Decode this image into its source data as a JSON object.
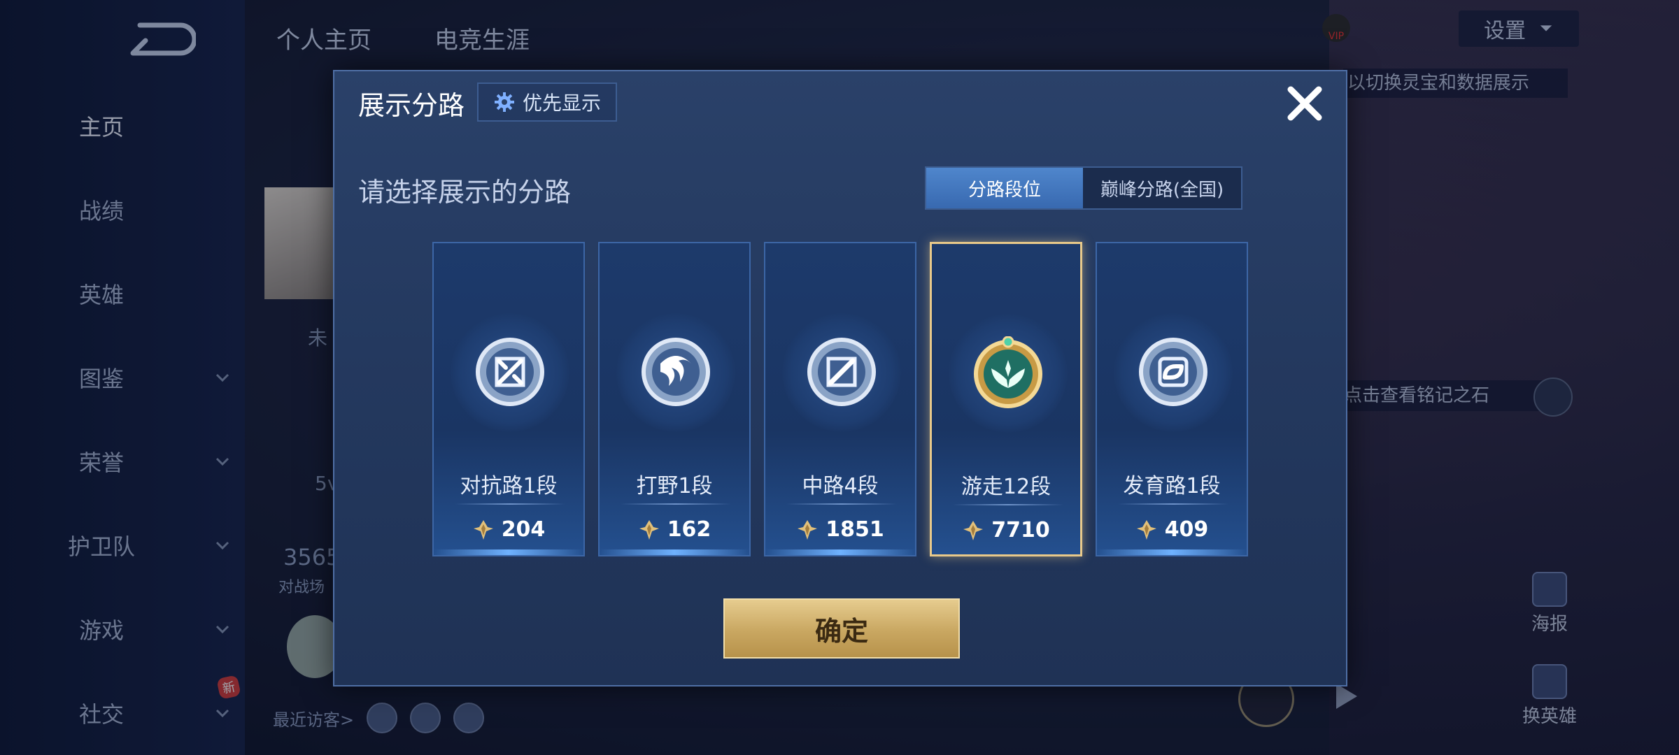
{
  "background": {
    "top_tabs": [
      "个人主页",
      "电竞生涯"
    ],
    "nav": [
      {
        "label": "主页",
        "has_chevron": false,
        "active": true
      },
      {
        "label": "战绩",
        "has_chevron": false
      },
      {
        "label": "英雄",
        "has_chevron": false
      },
      {
        "label": "图鉴",
        "has_chevron": true
      },
      {
        "label": "荣誉",
        "has_chevron": true
      },
      {
        "label": "护卫队",
        "has_chevron": true
      },
      {
        "label": "游戏",
        "has_chevron": true
      },
      {
        "label": "社交",
        "has_chevron": true
      }
    ],
    "new_badge": "新",
    "settings_label": "设置",
    "vip_label": "VIP",
    "hint_switch": "以切换灵宝和数据展示",
    "hint_stone": "点击查看铭记之石",
    "partial_texts": {
      "name": "未",
      "count": "5v",
      "stat": "3565",
      "stat_label": "对战场"
    },
    "visitors_label": "最近访客>",
    "side_actions": {
      "poster": "海报",
      "switch_hero": "换英雄"
    }
  },
  "dialog": {
    "title": "展示分路",
    "priority_button": "优先显示",
    "subtitle": "请选择展示的分路",
    "toggle": {
      "rank": "分路段位",
      "peak": "巅峰分路(全国)",
      "active": "rank"
    },
    "cards": [
      {
        "name": "对抗路1段",
        "score": "204",
        "icon": "sword-emblem-icon",
        "selected": false
      },
      {
        "name": "打野1段",
        "score": "162",
        "icon": "jungle-emblem-icon",
        "selected": false
      },
      {
        "name": "中路4段",
        "score": "1851",
        "icon": "mid-emblem-icon",
        "selected": false
      },
      {
        "name": "游走12段",
        "score": "7710",
        "icon": "roam-emblem-icon",
        "selected": true
      },
      {
        "name": "发育路1段",
        "score": "409",
        "icon": "adc-emblem-icon",
        "selected": false
      }
    ],
    "confirm_label": "确定"
  },
  "colors": {
    "accent_gold": "#e8c98a",
    "toggle_active": "#4f86cc",
    "confirm_gold": "#c9a761"
  }
}
